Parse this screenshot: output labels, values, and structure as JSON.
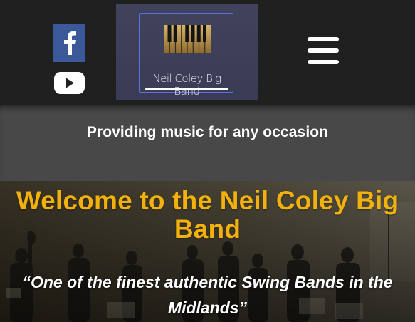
{
  "header": {
    "social": [
      {
        "name": "facebook",
        "icon": "facebook-icon",
        "color": "#3b5998"
      },
      {
        "name": "youtube",
        "icon": "youtube-icon",
        "color": "#ffffff"
      }
    ],
    "logo": {
      "text": "Neil Coley Big Band",
      "frame_color": "#5e6fe0",
      "key_color": "#b8914a"
    },
    "menu_icon": "hamburger-menu-icon"
  },
  "tagline": "Providing music for any occasion",
  "hero": {
    "title": "Welcome to the Neil Coley Big Band",
    "quote": "“One of the finest authentic Swing Bands in the Midlands”",
    "title_color": "#f2b10c"
  }
}
